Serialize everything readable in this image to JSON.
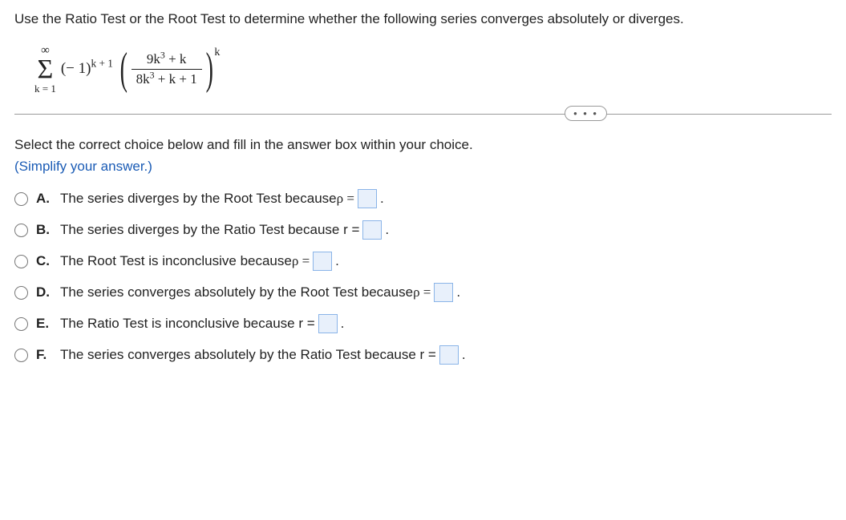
{
  "question": "Use the Ratio Test or the Root Test to determine whether the following series converges absolutely or diverges.",
  "formula": {
    "sigma_top": "∞",
    "sigma_bottom": "k = 1",
    "coef_base": "(− 1)",
    "coef_exp": "k + 1",
    "frac_top_1": "9k",
    "frac_top_exp1": "3",
    "frac_top_2": " + k",
    "frac_bot_1": "8k",
    "frac_bot_exp1": "3",
    "frac_bot_2": " + k + 1",
    "outer_exp": "k"
  },
  "dots": "• • •",
  "instruction": "Select the correct choice below and fill in the answer box within your choice.",
  "simplify": "(Simplify your answer.)",
  "choices": {
    "a": {
      "letter": "A.",
      "pre": "The series diverges by the Root Test because ",
      "var": "ρ =",
      "post": "."
    },
    "b": {
      "letter": "B.",
      "pre": "The series diverges by the Ratio Test because r = ",
      "var": "",
      "post": "."
    },
    "c": {
      "letter": "C.",
      "pre": "The Root Test is inconclusive because ",
      "var": "ρ =",
      "post": "."
    },
    "d": {
      "letter": "D.",
      "pre": "The series converges absolutely by the Root Test because ",
      "var": "ρ =",
      "post": "."
    },
    "e": {
      "letter": "E.",
      "pre": "The Ratio Test is inconclusive because r = ",
      "var": "",
      "post": "."
    },
    "f": {
      "letter": "F.",
      "pre": "The series converges absolutely by the Ratio Test because r = ",
      "var": "",
      "post": "."
    }
  }
}
